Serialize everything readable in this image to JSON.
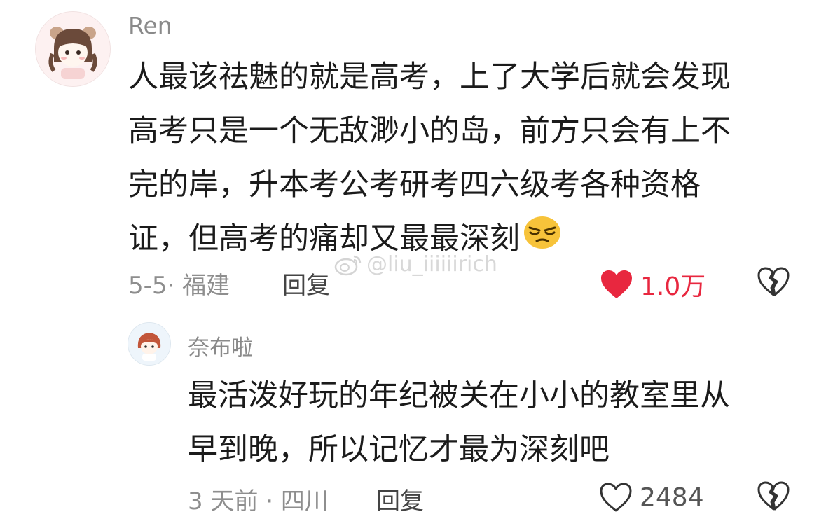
{
  "comment": {
    "author": "Ren",
    "lines": [
      "人最该祛魅的就是高考，上了大学后就会发现",
      "高考只是一个无敌渺小的岛，前方只会有上不",
      "完的岸，升本考公考研考四六级考各种资格",
      "证，但高考的痛却又最最深刻"
    ],
    "emoji": "pensive-face",
    "meta": "5-5· 福建",
    "reply_label": "回复",
    "likes": "1.0万",
    "liked_color": "#e8273f"
  },
  "watermark": "@liu_iiiiiirich",
  "reply": {
    "author": "奈布啦",
    "lines": [
      "最活泼好玩的年纪被关在小小的教室里从",
      "早到晚，所以记忆才最为深刻吧"
    ],
    "meta": "3 天前 · 四川",
    "reply_label": "回复",
    "likes": "2484"
  }
}
